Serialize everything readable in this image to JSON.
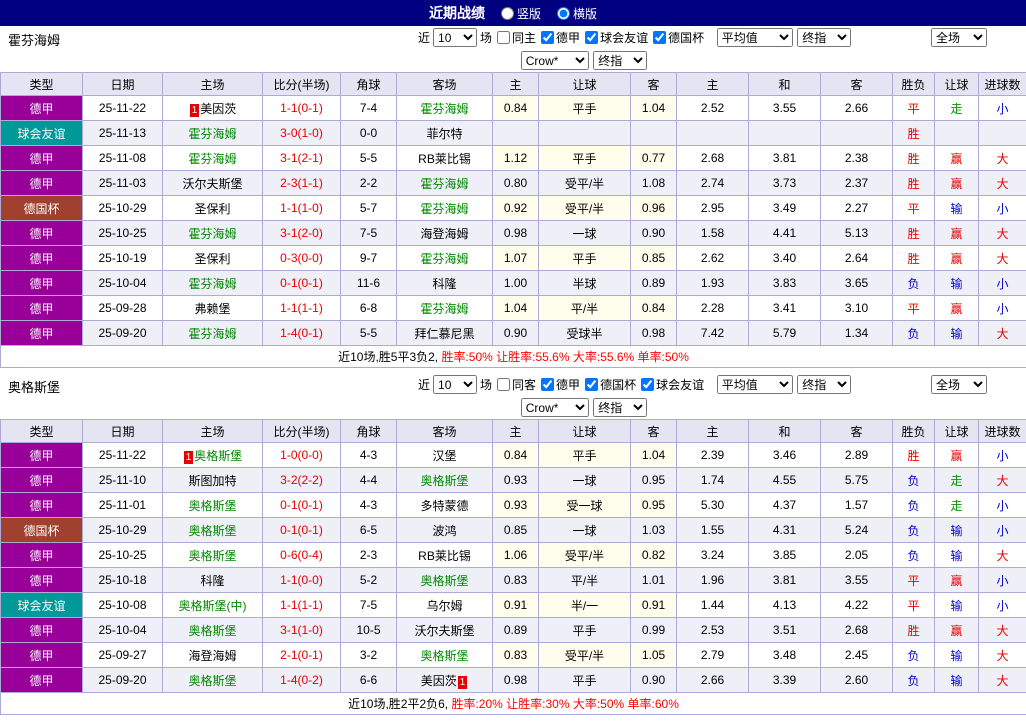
{
  "topbar": {
    "title": "近期战绩",
    "options": [
      {
        "label": "竖版",
        "selected": false
      },
      {
        "label": "横版",
        "selected": true
      }
    ]
  },
  "labels": {
    "recent": "近",
    "matches": "场"
  },
  "table_headers": [
    "类型",
    "日期",
    "主场",
    "比分(半场)",
    "角球",
    "客场",
    "主",
    "让球",
    "客",
    "主",
    "和",
    "客",
    "胜负",
    "让球",
    "进球数"
  ],
  "colors": {
    "type_badges": {
      "德甲": "#990099",
      "球会友谊": "#009999",
      "德国杯": "#A0402F"
    },
    "results": {
      "胜": "#E60000",
      "平": "#E60000",
      "负": "#0000CC",
      "赢": "#E60000",
      "走": "#009900",
      "输": "#0000CC",
      "大": "#E60000",
      "小": "#0000CC"
    },
    "focal_team": "#008800",
    "score": "#E60000",
    "rank_badge": "#E60000"
  },
  "sections": [
    {
      "team": "霍芬海姆",
      "selects": {
        "count": "10",
        "crow": "Crow*",
        "crow_type": "终指",
        "avg": "平均值",
        "avg_type": "终指",
        "scope": "全场"
      },
      "filters": [
        {
          "label": "同主",
          "checked": false
        },
        {
          "label": "德甲",
          "checked": true
        },
        {
          "label": "球会友谊",
          "checked": true
        },
        {
          "label": "德国杯",
          "checked": true
        }
      ],
      "rows": [
        {
          "type": "德甲",
          "date": "25-11-22",
          "home": "美因茨",
          "home_badge": "1",
          "home_badge_after": false,
          "home_focal": false,
          "score": "1-1(0-1)",
          "corners": "7-4",
          "away": "霍芬海姆",
          "away_badge": "",
          "away_badge_after": false,
          "away_focal": true,
          "crow": [
            "0.84",
            "平手",
            "1.04"
          ],
          "avg": [
            "2.52",
            "3.55",
            "2.66"
          ],
          "results": [
            "平",
            "走",
            "小"
          ]
        },
        {
          "type": "球会友谊",
          "date": "25-11-13",
          "home": "霍芬海姆",
          "home_badge": "",
          "home_badge_after": false,
          "home_focal": true,
          "score": "3-0(1-0)",
          "corners": "0-0",
          "away": "菲尔特",
          "away_badge": "",
          "away_badge_after": false,
          "away_focal": false,
          "crow": [
            "",
            "",
            ""
          ],
          "avg": [
            "",
            "",
            ""
          ],
          "results": [
            "胜",
            "",
            ""
          ]
        },
        {
          "type": "德甲",
          "date": "25-11-08",
          "home": "霍芬海姆",
          "home_badge": "",
          "home_badge_after": false,
          "home_focal": true,
          "score": "3-1(2-1)",
          "corners": "5-5",
          "away": "RB莱比锡",
          "away_badge": "",
          "away_badge_after": false,
          "away_focal": false,
          "crow": [
            "1.12",
            "平手",
            "0.77"
          ],
          "avg": [
            "2.68",
            "3.81",
            "2.38"
          ],
          "results": [
            "胜",
            "赢",
            "大"
          ]
        },
        {
          "type": "德甲",
          "date": "25-11-03",
          "home": "沃尔夫斯堡",
          "home_badge": "",
          "home_badge_after": false,
          "home_focal": false,
          "score": "2-3(1-1)",
          "corners": "2-2",
          "away": "霍芬海姆",
          "away_badge": "",
          "away_badge_after": false,
          "away_focal": true,
          "crow": [
            "0.80",
            "受平/半",
            "1.08"
          ],
          "avg": [
            "2.74",
            "3.73",
            "2.37"
          ],
          "results": [
            "胜",
            "赢",
            "大"
          ]
        },
        {
          "type": "德国杯",
          "date": "25-10-29",
          "home": "圣保利",
          "home_badge": "",
          "home_badge_after": false,
          "home_focal": false,
          "score": "1-1(1-0)",
          "corners": "5-7",
          "away": "霍芬海姆",
          "away_badge": "",
          "away_badge_after": false,
          "away_focal": true,
          "crow": [
            "0.92",
            "受平/半",
            "0.96"
          ],
          "avg": [
            "2.95",
            "3.49",
            "2.27"
          ],
          "results": [
            "平",
            "输",
            "小"
          ]
        },
        {
          "type": "德甲",
          "date": "25-10-25",
          "home": "霍芬海姆",
          "home_badge": "",
          "home_badge_after": false,
          "home_focal": true,
          "score": "3-1(2-0)",
          "corners": "7-5",
          "away": "海登海姆",
          "away_badge": "",
          "away_badge_after": false,
          "away_focal": false,
          "crow": [
            "0.98",
            "一球",
            "0.90"
          ],
          "avg": [
            "1.58",
            "4.41",
            "5.13"
          ],
          "results": [
            "胜",
            "赢",
            "大"
          ]
        },
        {
          "type": "德甲",
          "date": "25-10-19",
          "home": "圣保利",
          "home_badge": "",
          "home_badge_after": false,
          "home_focal": false,
          "score": "0-3(0-0)",
          "corners": "9-7",
          "away": "霍芬海姆",
          "away_badge": "",
          "away_badge_after": false,
          "away_focal": true,
          "crow": [
            "1.07",
            "平手",
            "0.85"
          ],
          "avg": [
            "2.62",
            "3.40",
            "2.64"
          ],
          "results": [
            "胜",
            "赢",
            "大"
          ]
        },
        {
          "type": "德甲",
          "date": "25-10-04",
          "home": "霍芬海姆",
          "home_badge": "",
          "home_badge_after": false,
          "home_focal": true,
          "score": "0-1(0-1)",
          "corners": "11-6",
          "away": "科隆",
          "away_badge": "",
          "away_badge_after": false,
          "away_focal": false,
          "crow": [
            "1.00",
            "半球",
            "0.89"
          ],
          "avg": [
            "1.93",
            "3.83",
            "3.65"
          ],
          "results": [
            "负",
            "输",
            "小"
          ]
        },
        {
          "type": "德甲",
          "date": "25-09-28",
          "home": "弗赖堡",
          "home_badge": "",
          "home_badge_after": false,
          "home_focal": false,
          "score": "1-1(1-1)",
          "corners": "6-8",
          "away": "霍芬海姆",
          "away_badge": "",
          "away_badge_after": false,
          "away_focal": true,
          "crow": [
            "1.04",
            "平/半",
            "0.84"
          ],
          "avg": [
            "2.28",
            "3.41",
            "3.10"
          ],
          "results": [
            "平",
            "赢",
            "小"
          ]
        },
        {
          "type": "德甲",
          "date": "25-09-20",
          "home": "霍芬海姆",
          "home_badge": "",
          "home_badge_after": false,
          "home_focal": true,
          "score": "1-4(0-1)",
          "corners": "5-5",
          "away": "拜仁慕尼黑",
          "away_badge": "",
          "away_badge_after": false,
          "away_focal": false,
          "crow": [
            "0.90",
            "受球半",
            "0.98"
          ],
          "avg": [
            "7.42",
            "5.79",
            "1.34"
          ],
          "results": [
            "负",
            "输",
            "大"
          ]
        }
      ],
      "summary": [
        {
          "text": "近10场,胜5平3负2,",
          "color": "#000000"
        },
        {
          "text": " 胜率:50% 让胜率:55.6% 大率:55.6% 单率:50%",
          "color": "#FF0000"
        }
      ]
    },
    {
      "team": "奥格斯堡",
      "selects": {
        "count": "10",
        "crow": "Crow*",
        "crow_type": "终指",
        "avg": "平均值",
        "avg_type": "终指",
        "scope": "全场"
      },
      "filters": [
        {
          "label": "同客",
          "checked": false
        },
        {
          "label": "德甲",
          "checked": true
        },
        {
          "label": "德国杯",
          "checked": true
        },
        {
          "label": "球会友谊",
          "checked": true
        }
      ],
      "rows": [
        {
          "type": "德甲",
          "date": "25-11-22",
          "home": "奥格斯堡",
          "home_badge": "1",
          "home_badge_after": false,
          "home_focal": true,
          "score": "1-0(0-0)",
          "corners": "4-3",
          "away": "汉堡",
          "away_badge": "",
          "away_badge_after": false,
          "away_focal": false,
          "crow": [
            "0.84",
            "平手",
            "1.04"
          ],
          "avg": [
            "2.39",
            "3.46",
            "2.89"
          ],
          "results": [
            "胜",
            "赢",
            "小"
          ]
        },
        {
          "type": "德甲",
          "date": "25-11-10",
          "home": "斯图加特",
          "home_badge": "",
          "home_badge_after": false,
          "home_focal": false,
          "score": "3-2(2-2)",
          "corners": "4-4",
          "away": "奥格斯堡",
          "away_badge": "",
          "away_badge_after": false,
          "away_focal": true,
          "crow": [
            "0.93",
            "一球",
            "0.95"
          ],
          "avg": [
            "1.74",
            "4.55",
            "5.75"
          ],
          "results": [
            "负",
            "走",
            "大"
          ]
        },
        {
          "type": "德甲",
          "date": "25-11-01",
          "home": "奥格斯堡",
          "home_badge": "",
          "home_badge_after": false,
          "home_focal": true,
          "score": "0-1(0-1)",
          "corners": "4-3",
          "away": "多特蒙德",
          "away_badge": "",
          "away_badge_after": false,
          "away_focal": false,
          "crow": [
            "0.93",
            "受一球",
            "0.95"
          ],
          "avg": [
            "5.30",
            "4.37",
            "1.57"
          ],
          "results": [
            "负",
            "走",
            "小"
          ]
        },
        {
          "type": "德国杯",
          "date": "25-10-29",
          "home": "奥格斯堡",
          "home_badge": "",
          "home_badge_after": false,
          "home_focal": true,
          "score": "0-1(0-1)",
          "corners": "6-5",
          "away": "波鸿",
          "away_badge": "",
          "away_badge_after": false,
          "away_focal": false,
          "crow": [
            "0.85",
            "一球",
            "1.03"
          ],
          "avg": [
            "1.55",
            "4.31",
            "5.24"
          ],
          "results": [
            "负",
            "输",
            "小"
          ]
        },
        {
          "type": "德甲",
          "date": "25-10-25",
          "home": "奥格斯堡",
          "home_badge": "",
          "home_badge_after": false,
          "home_focal": true,
          "score": "0-6(0-4)",
          "corners": "2-3",
          "away": "RB莱比锡",
          "away_badge": "",
          "away_badge_after": false,
          "away_focal": false,
          "crow": [
            "1.06",
            "受平/半",
            "0.82"
          ],
          "avg": [
            "3.24",
            "3.85",
            "2.05"
          ],
          "results": [
            "负",
            "输",
            "大"
          ]
        },
        {
          "type": "德甲",
          "date": "25-10-18",
          "home": "科隆",
          "home_badge": "",
          "home_badge_after": false,
          "home_focal": false,
          "score": "1-1(0-0)",
          "corners": "5-2",
          "away": "奥格斯堡",
          "away_badge": "",
          "away_badge_after": false,
          "away_focal": true,
          "crow": [
            "0.83",
            "平/半",
            "1.01"
          ],
          "avg": [
            "1.96",
            "3.81",
            "3.55"
          ],
          "results": [
            "平",
            "赢",
            "小"
          ]
        },
        {
          "type": "球会友谊",
          "date": "25-10-08",
          "home": "奥格斯堡(中)",
          "home_badge": "",
          "home_badge_after": false,
          "home_focal": true,
          "score": "1-1(1-1)",
          "corners": "7-5",
          "away": "乌尔姆",
          "away_badge": "",
          "away_badge_after": false,
          "away_focal": false,
          "crow": [
            "0.91",
            "半/一",
            "0.91"
          ],
          "avg": [
            "1.44",
            "4.13",
            "4.22"
          ],
          "results": [
            "平",
            "输",
            "小"
          ]
        },
        {
          "type": "德甲",
          "date": "25-10-04",
          "home": "奥格斯堡",
          "home_badge": "",
          "home_badge_after": false,
          "home_focal": true,
          "score": "3-1(1-0)",
          "corners": "10-5",
          "away": "沃尔夫斯堡",
          "away_badge": "",
          "away_badge_after": false,
          "away_focal": false,
          "crow": [
            "0.89",
            "平手",
            "0.99"
          ],
          "avg": [
            "2.53",
            "3.51",
            "2.68"
          ],
          "results": [
            "胜",
            "赢",
            "大"
          ]
        },
        {
          "type": "德甲",
          "date": "25-09-27",
          "home": "海登海姆",
          "home_badge": "",
          "home_badge_after": false,
          "home_focal": false,
          "score": "2-1(0-1)",
          "corners": "3-2",
          "away": "奥格斯堡",
          "away_badge": "",
          "away_badge_after": false,
          "away_focal": true,
          "crow": [
            "0.83",
            "受平/半",
            "1.05"
          ],
          "avg": [
            "2.79",
            "3.48",
            "2.45"
          ],
          "results": [
            "负",
            "输",
            "大"
          ]
        },
        {
          "type": "德甲",
          "date": "25-09-20",
          "home": "奥格斯堡",
          "home_badge": "",
          "home_badge_after": false,
          "home_focal": true,
          "score": "1-4(0-2)",
          "corners": "6-6",
          "away": "美因茨",
          "away_badge": "1",
          "away_badge_after": true,
          "away_focal": false,
          "crow": [
            "0.98",
            "平手",
            "0.90"
          ],
          "avg": [
            "2.66",
            "3.39",
            "2.60"
          ],
          "results": [
            "负",
            "输",
            "大"
          ]
        }
      ],
      "summary": [
        {
          "text": "近10场,胜2平2负6,",
          "color": "#000000"
        },
        {
          "text": " 胜率:20% 让胜率:30% 大率:50% 单率:60%",
          "color": "#FF0000"
        }
      ]
    }
  ]
}
